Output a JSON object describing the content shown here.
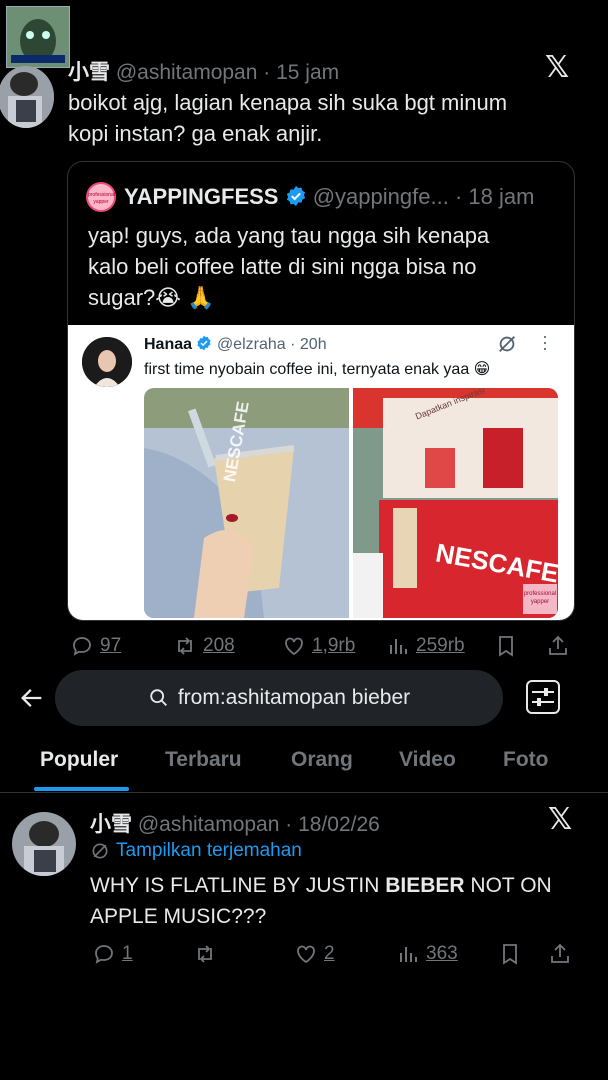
{
  "tweet1": {
    "display_name": "小雪",
    "handle": "@ashitamopan",
    "time": "15 jam",
    "text_line1": "boikot ajg, lagian kenapa sih suka bgt minum",
    "text_line2": "kopi instan? ga enak anjir.",
    "quote": {
      "name": "YAPPINGFESS",
      "handle": "@yappingfe...",
      "time": "18 jam",
      "text_line1": "yap! guys, ada yang tau ngga sih kenapa",
      "text_line2": "kalo beli coffee latte di sini ngga bisa no",
      "text_line3": "sugar?😭 🙏",
      "avatar_text": "professional yapper",
      "embedded": {
        "name": "Hanaa",
        "handle": "@elzraha",
        "time": "20h",
        "text": "first time nyobain coffee ini, ternyata enak yaa 😁",
        "cup_text": "NESCAFE",
        "booth_text": "NESCAFE",
        "booth_sign": "Dapatkan inspirasi",
        "watermark": "professional yapper"
      }
    },
    "actions": {
      "replies": "97",
      "retweets": "208",
      "likes": "1,9rb",
      "views": "259rb"
    }
  },
  "search": {
    "query": "from:ashitamopan bieber"
  },
  "tabs": [
    "Populer",
    "Terbaru",
    "Orang",
    "Video",
    "Foto"
  ],
  "tweet2": {
    "display_name": "小雪",
    "handle": "@ashitamopan",
    "time": "18/02/26",
    "translate": "Tampilkan terjemahan",
    "text_line1_a": "WHY IS FLATLINE BY JUSTIN ",
    "text_line1_b": "BIEBER",
    "text_line1_c": " NOT ON",
    "text_line2": "APPLE MUSIC???",
    "actions": {
      "replies": "1",
      "retweets": "",
      "likes": "2",
      "views": "363"
    }
  },
  "colors": {
    "accent": "#1d9bf0",
    "background": "#000000",
    "muted": "#71767b",
    "verified": "#1d9bf0"
  }
}
